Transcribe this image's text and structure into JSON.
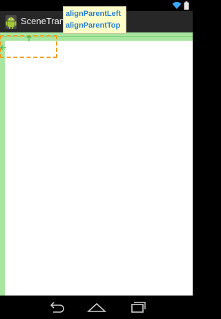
{
  "status_bar": {
    "icons": [
      "wifi-icon",
      "battery-icon"
    ]
  },
  "action_bar": {
    "title": "SceneTran",
    "icon": "android-robot-icon"
  },
  "tooltip": {
    "lines": [
      "alignParentLeft",
      "alignParentTop"
    ]
  },
  "layout_editor": {
    "anchors": [
      "arrow-left-icon",
      "arrow-up-icon"
    ],
    "colors": {
      "outline": "#a8e6a0",
      "selection": "#f0a020",
      "anchor": "#2fae3a",
      "tooltip_text": "#2a7fd4",
      "tooltip_bg": "#ffffc8"
    }
  },
  "nav_bar": {
    "buttons": [
      "back-icon",
      "home-icon",
      "recents-icon"
    ]
  }
}
